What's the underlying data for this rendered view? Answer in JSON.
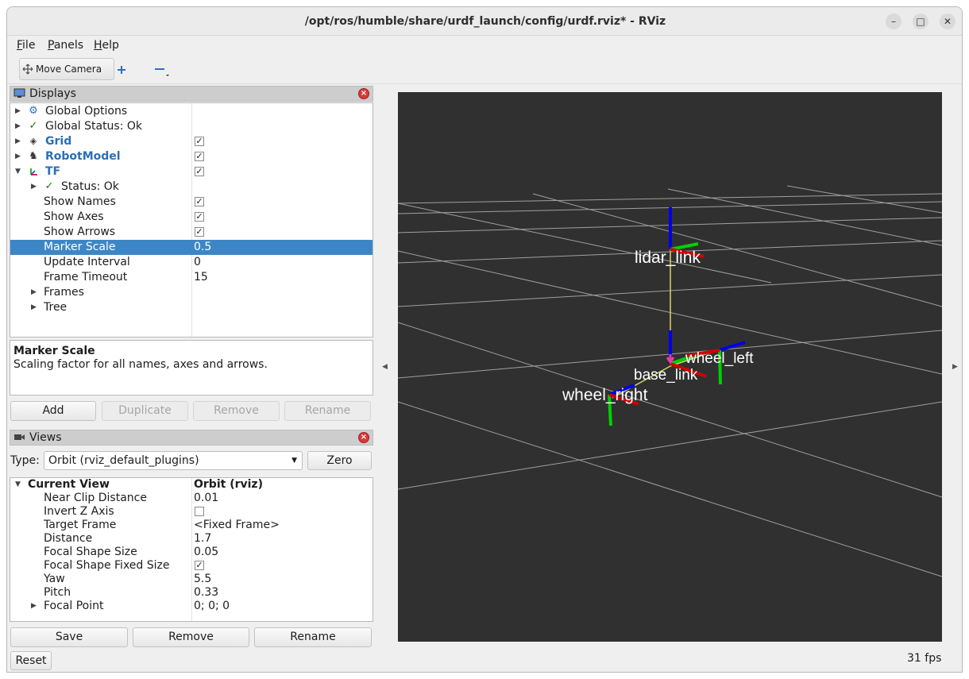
{
  "window": {
    "title": "/opt/ros/humble/share/urdf_launch/config/urdf.rviz* - RViz",
    "controls": [
      "minimize-icon",
      "maximize-icon",
      "close-icon"
    ]
  },
  "menubar": {
    "items": [
      {
        "label": "File",
        "mnemonic": "F",
        "rest": "ile"
      },
      {
        "label": "Panels",
        "mnemonic": "P",
        "rest": "anels"
      },
      {
        "label": "Help",
        "mnemonic": "H",
        "rest": "elp"
      }
    ]
  },
  "toolbar": {
    "move_camera": "Move Camera",
    "add_icon": "plus-icon",
    "remove_icon": "minus-icon"
  },
  "displays": {
    "title": "Displays",
    "rows": [
      {
        "name": "Global Options",
        "value": "",
        "icon": "gear-icon"
      },
      {
        "name": "Global Status: Ok",
        "value": "",
        "icon": "checkmark-icon"
      },
      {
        "name": "Grid",
        "value": "✓",
        "icon": "grid-icon"
      },
      {
        "name": "RobotModel",
        "value": "✓",
        "icon": "robot-icon"
      },
      {
        "name": "TF",
        "value": "✓",
        "icon": "axes-icon"
      },
      {
        "name": "Status: Ok",
        "value": "",
        "icon": "checkmark-icon"
      },
      {
        "name": "Show Names",
        "value": "✓"
      },
      {
        "name": "Show Axes",
        "value": "✓"
      },
      {
        "name": "Show Arrows",
        "value": "✓"
      },
      {
        "name": "Marker Scale",
        "value": "0.5"
      },
      {
        "name": "Update Interval",
        "value": "0"
      },
      {
        "name": "Frame Timeout",
        "value": "15"
      },
      {
        "name": "Frames",
        "value": ""
      },
      {
        "name": "Tree",
        "value": ""
      }
    ],
    "help_title": "Marker Scale",
    "help_text": "Scaling factor for all names, axes and arrows.",
    "buttons": {
      "add": "Add",
      "duplicate": "Duplicate",
      "remove": "Remove",
      "rename": "Rename"
    }
  },
  "views": {
    "title": "Views",
    "type_label": "Type:",
    "type_value": "Orbit (rviz_default_plugins)",
    "zero": "Zero",
    "current_view": "Current View",
    "current_view_value": "Orbit (rviz)",
    "rows": [
      {
        "name": "Near Clip Distance",
        "value": "0.01"
      },
      {
        "name": "Invert Z Axis",
        "value": ""
      },
      {
        "name": "Target Frame",
        "value": "<Fixed Frame>"
      },
      {
        "name": "Distance",
        "value": "1.7"
      },
      {
        "name": "Focal Shape Size",
        "value": "0.05"
      },
      {
        "name": "Focal Shape Fixed Size",
        "value": "✓"
      },
      {
        "name": "Yaw",
        "value": "5.5"
      },
      {
        "name": "Pitch",
        "value": "0.33"
      },
      {
        "name": "Focal Point",
        "value": "0; 0; 0"
      }
    ],
    "buttons": {
      "save": "Save",
      "remove": "Remove",
      "rename": "Rename"
    }
  },
  "reset": "Reset",
  "viewport": {
    "frames": {
      "lidar": "lidar_link",
      "base": "base_link",
      "wheel_left": "wheel_left",
      "wheel_right": "wheel_right"
    },
    "background": "#303030"
  },
  "fps": "31 fps",
  "colors": {
    "selection": "#3d86c6",
    "link_text": "#2a6fb5",
    "axis_x": "#d00000",
    "axis_y": "#00d000",
    "axis_z": "#0000e0"
  }
}
